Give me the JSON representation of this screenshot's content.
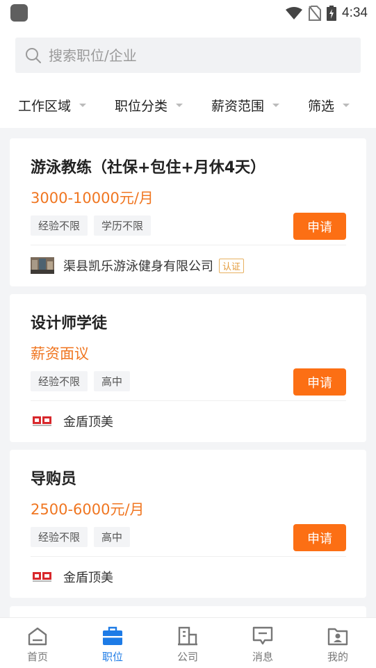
{
  "status_bar": {
    "time": "4:34"
  },
  "search": {
    "placeholder": "搜索职位/企业"
  },
  "filters": [
    {
      "label": "工作区域"
    },
    {
      "label": "职位分类"
    },
    {
      "label": "薪资范围"
    },
    {
      "label": "筛选"
    }
  ],
  "jobs": [
    {
      "title": "游泳教练（社保+包住+月休4天）",
      "salary": "3000-10000元/月",
      "tags": [
        "经验不限",
        "学历不限"
      ],
      "apply_label": "申请",
      "company": "渠县凯乐游泳健身有限公司",
      "verified_label": "认证"
    },
    {
      "title": "设计师学徒",
      "salary": "薪资面议",
      "tags": [
        "经验不限",
        "高中"
      ],
      "apply_label": "申请",
      "company": "金盾顶美"
    },
    {
      "title": "导购员",
      "salary": "2500-6000元/月",
      "tags": [
        "经验不限",
        "高中"
      ],
      "apply_label": "申请",
      "company": "金盾顶美"
    }
  ],
  "tabbar": {
    "active_color": "#1d7be6",
    "items": [
      {
        "label": "首页",
        "icon": "home-icon"
      },
      {
        "label": "职位",
        "icon": "briefcase-icon"
      },
      {
        "label": "公司",
        "icon": "building-icon"
      },
      {
        "label": "消息",
        "icon": "message-icon"
      },
      {
        "label": "我的",
        "icon": "profile-icon"
      }
    ]
  },
  "colors": {
    "accent_orange": "#fc6f14",
    "salary_orange": "#f07621"
  }
}
